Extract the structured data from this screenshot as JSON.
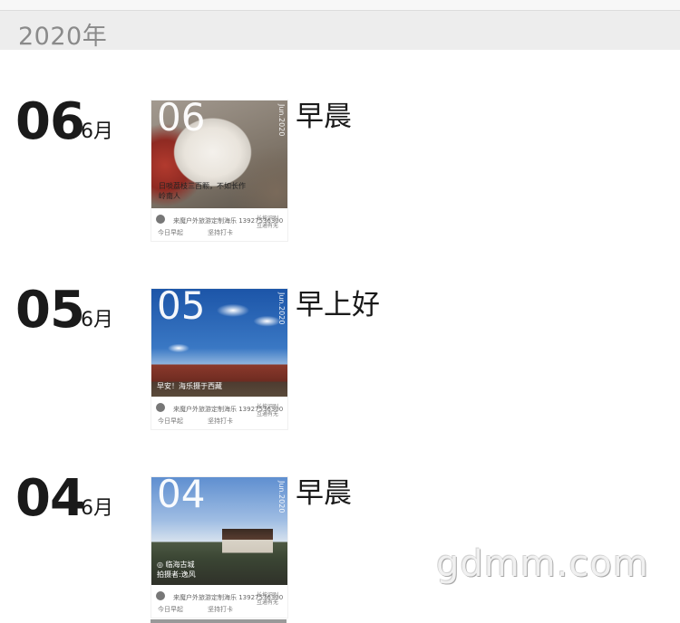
{
  "year_header": "2020年",
  "entries": [
    {
      "day": "06",
      "month": "6月",
      "title": "早晨",
      "card": {
        "num": "06",
        "vertical": "Jun.2020",
        "caption": "日啖荔枝三百颗，不如长作\n岭南人",
        "name": "来魔户外旅游定制海乐 13927536300",
        "left1": "今日早起",
        "left2": "坚持打卡",
        "right": "长按识别\n互通有无"
      }
    },
    {
      "day": "05",
      "month": "6月",
      "title": "早上好",
      "card": {
        "num": "05",
        "vertical": "Jun.2020",
        "caption": "早安！海乐摄于西藏",
        "name": "来魔户外旅游定制海乐 13927536300",
        "left1": "今日早起",
        "left2": "坚持打卡",
        "right": "长按识别\n互通有无"
      }
    },
    {
      "day": "04",
      "month": "6月",
      "title": "早晨",
      "card": {
        "num": "04",
        "vertical": "Jun.2020",
        "caption": "◎ 临海古城\n拍摄者:逸风",
        "name": "来魔户外旅游定制海乐 13927536300",
        "left1": "今日早起",
        "left2": "坚持打卡",
        "right": "长按识别\n互通有无"
      }
    }
  ],
  "watermark": "gdmm.com"
}
